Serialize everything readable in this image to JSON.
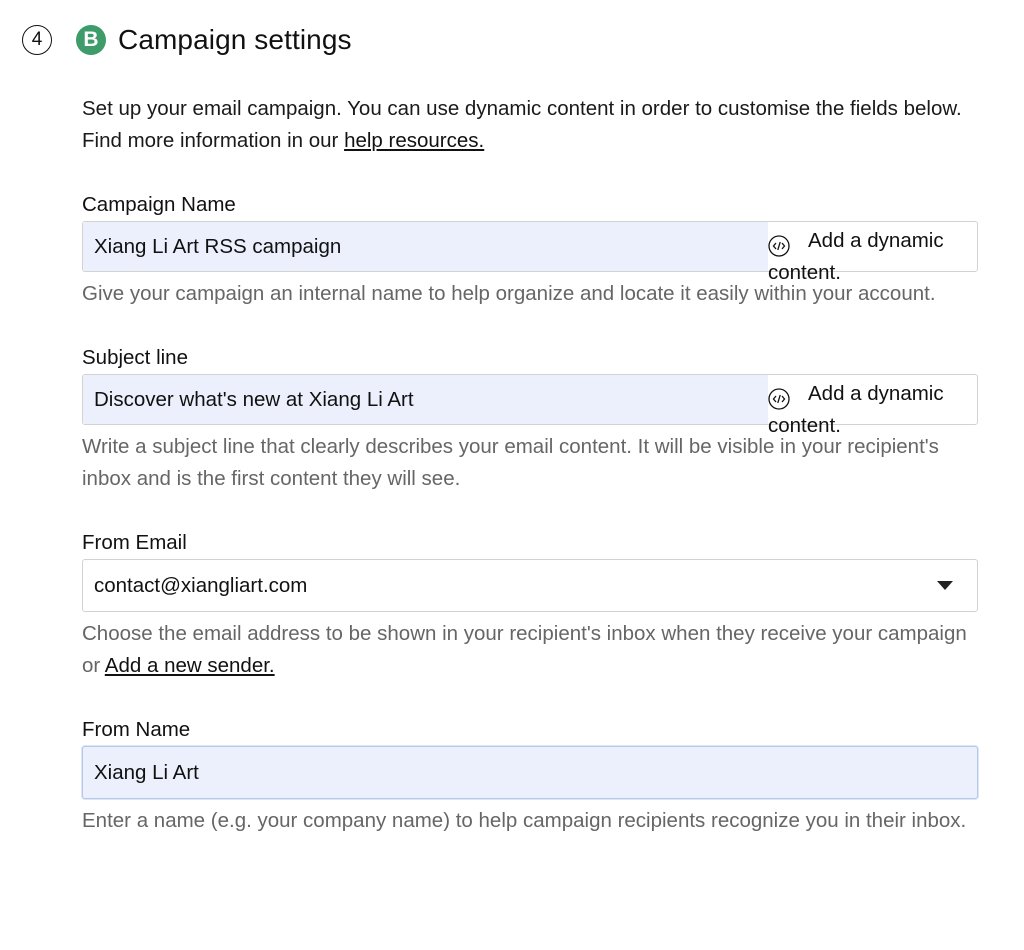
{
  "header": {
    "step_number": "4",
    "badge_letter": "B",
    "badge_color": "#3e9b6a",
    "title": "Campaign settings"
  },
  "intro": {
    "text": "Set up your email campaign. You can use dynamic content in order to customise the fields below. Find more information in our ",
    "link": "help resources."
  },
  "fields": {
    "campaign_name": {
      "label": "Campaign Name",
      "value": "Xiang Li Art RSS campaign",
      "dynamic_button": "Add a dynamic content.",
      "dynamic_icon": "code-icon",
      "help": "Give your campaign an internal name to help organize and locate it easily within your account."
    },
    "subject_line": {
      "label": "Subject line",
      "value": "Discover what's new at Xiang Li Art",
      "dynamic_button": "Add a dynamic content.",
      "dynamic_icon": "code-icon",
      "help": "Write a subject line that clearly describes your email content. It will be visible in your recipient's inbox and is the first content they will see."
    },
    "from_email": {
      "label": "From Email",
      "value": "contact@xiangliart.com",
      "caret_icon": "caret-down-icon",
      "help": "Choose the email address to be shown in your recipient's inbox when they receive your campaign or ",
      "help_link": "Add a new sender."
    },
    "from_name": {
      "label": "From Name",
      "value": "Xiang Li Art",
      "help": "Enter a name (e.g. your company name) to help campaign recipients recognize you in their inbox."
    }
  }
}
